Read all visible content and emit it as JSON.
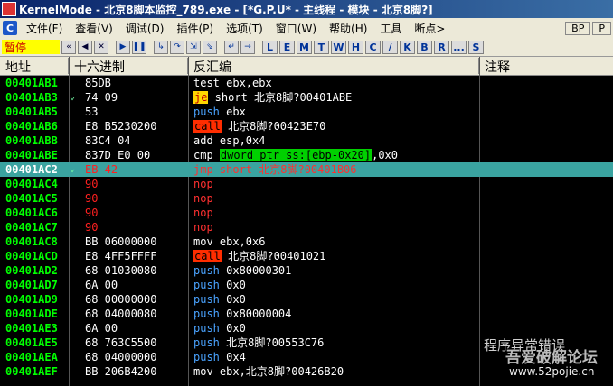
{
  "window": {
    "title": "KernelMode - 北京8脚本监控_789.exe - [*G.P.U* - 主线程 - 模块 - 北京8脚?]"
  },
  "menu": {
    "icon": "C",
    "items": [
      "文件(F)",
      "查看(V)",
      "调试(D)",
      "插件(P)",
      "选项(T)",
      "窗口(W)",
      "帮助(H)",
      "工具",
      "断点>"
    ],
    "right_buttons": [
      "BP",
      "P"
    ]
  },
  "toolbar": {
    "status": "暂停",
    "nav_icons": [
      "rewind-icon",
      "back-icon",
      "close-icon",
      "play-icon",
      "pause-icon",
      "step-into-icon",
      "step-over-icon",
      "trace-into-icon",
      "trace-over-icon",
      "run-to-return-icon",
      "goto-icon"
    ],
    "window_letters": [
      "L",
      "E",
      "M",
      "T",
      "W",
      "H",
      "C",
      "/",
      "K",
      "B",
      "R",
      "...",
      "S"
    ]
  },
  "columns": {
    "addr": "地址",
    "hex": "十六进制",
    "disasm": "反汇编",
    "comment": "注释"
  },
  "rows": [
    {
      "addr": "00401AB1",
      "hex": "85DB",
      "mn": "test",
      "op": " ebx,ebx"
    },
    {
      "addr": "00401AB3",
      "hex": "74 09",
      "mn": "je",
      "op": " short 北京8脚?00401ABE",
      "marker": "⌄",
      "mnStyle": "je"
    },
    {
      "addr": "00401AB5",
      "hex": "53",
      "mn": "push",
      "op": " ebx",
      "mnColor": "blue"
    },
    {
      "addr": "00401AB6",
      "hex": "E8 B5230200",
      "mn": "call",
      "op": " 北京8脚?00423E70",
      "mnStyle": "call"
    },
    {
      "addr": "00401ABB",
      "hex": "83C4 04",
      "mn": "add",
      "op": " esp,0x4"
    },
    {
      "addr": "00401ABE",
      "hex": "837D E0 00",
      "mn": "cmp",
      "op_parts": [
        " ",
        "dword ptr ss:[ebp-0x20]",
        ",0x0"
      ]
    },
    {
      "addr": "00401AC2",
      "hex": "EB 42",
      "mn": "jmp",
      "op": " short 北京8脚?00401B06",
      "marker": "⌄",
      "selected": true,
      "hexRed": true,
      "mnColor": "red"
    },
    {
      "addr": "00401AC4",
      "hex": "90",
      "mn": "nop",
      "op": "",
      "hexRed": true,
      "mnColor": "red"
    },
    {
      "addr": "00401AC5",
      "hex": "90",
      "mn": "nop",
      "op": "",
      "hexRed": true,
      "mnColor": "red"
    },
    {
      "addr": "00401AC6",
      "hex": "90",
      "mn": "nop",
      "op": "",
      "hexRed": true,
      "mnColor": "red"
    },
    {
      "addr": "00401AC7",
      "hex": "90",
      "mn": "nop",
      "op": "",
      "hexRed": true,
      "mnColor": "red"
    },
    {
      "addr": "00401AC8",
      "hex": "BB 06000000",
      "mn": "mov",
      "op": " ebx,0x6"
    },
    {
      "addr": "00401ACD",
      "hex": "E8 4FF5FFFF",
      "mn": "call",
      "op": " 北京8脚?00401021",
      "mnStyle": "call"
    },
    {
      "addr": "00401AD2",
      "hex": "68 01030080",
      "mn": "push",
      "op": " 0x80000301",
      "mnColor": "blue"
    },
    {
      "addr": "00401AD7",
      "hex": "6A 00",
      "mn": "push",
      "op": " 0x0",
      "mnColor": "blue"
    },
    {
      "addr": "00401AD9",
      "hex": "68 00000000",
      "mn": "push",
      "op": " 0x0",
      "mnColor": "blue"
    },
    {
      "addr": "00401ADE",
      "hex": "68 04000080",
      "mn": "push",
      "op": " 0x80000004",
      "mnColor": "blue"
    },
    {
      "addr": "00401AE3",
      "hex": "6A 00",
      "mn": "push",
      "op": " 0x0",
      "mnColor": "blue"
    },
    {
      "addr": "00401AE5",
      "hex": "68 763C5500",
      "mn": "push",
      "op": " 北京8脚?00553C76",
      "mnColor": "blue"
    },
    {
      "addr": "00401AEA",
      "hex": "68 04000000",
      "mn": "push",
      "op": " 0x4",
      "mnColor": "blue"
    },
    {
      "addr": "00401AEF",
      "hex": "BB 206B4200",
      "mn": "mov",
      "op": " ebx,北京8脚?00426B20"
    }
  ],
  "overlay": {
    "comment_text": "程序异常错误",
    "site_name": "吾爱破解论坛",
    "site_url": "www.52pojie.cn"
  },
  "colors": {
    "addr": "#00ff00",
    "selected_row": "#3aa3a0",
    "call_bg": "#ff2d00",
    "je_bg": "#ffd700",
    "mem_bg": "#00d000"
  }
}
